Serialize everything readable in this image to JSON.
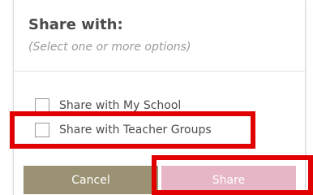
{
  "dialog": {
    "title": "Share with:",
    "subtitle": "(Select one or more options)"
  },
  "options": [
    {
      "label": "Share with My School",
      "checked": false
    },
    {
      "label": "Share with Teacher Groups",
      "checked": false
    }
  ],
  "buttons": {
    "cancel_label": "Cancel",
    "share_label": "Share"
  },
  "colors": {
    "highlight": "#e00000",
    "cancel_bg": "#9a9272",
    "share_bg": "#e7b6c6",
    "text": "#4b4b4b",
    "subtitle": "#9a9a9a"
  }
}
